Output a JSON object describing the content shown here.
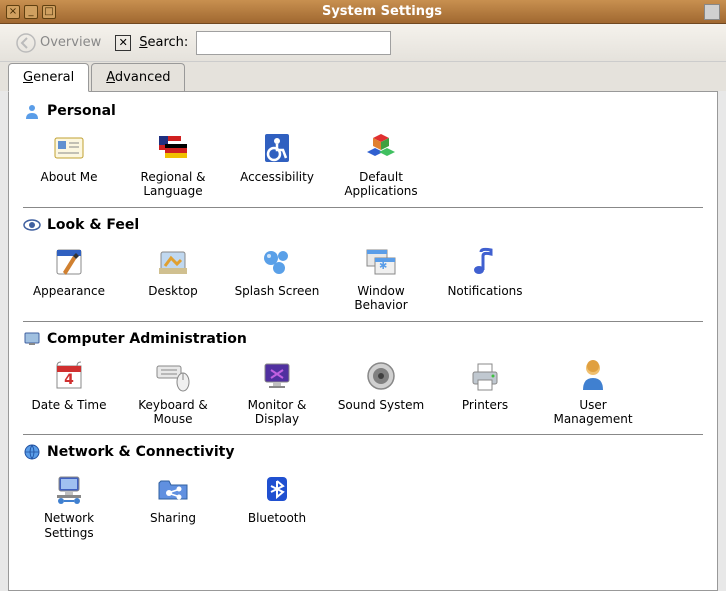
{
  "window": {
    "title": "System Settings"
  },
  "toolbar": {
    "overview": "Overview",
    "search_label": "Search:",
    "search_value": "",
    "search_placeholder": ""
  },
  "tabs": {
    "general": "General",
    "advanced": "Advanced"
  },
  "sections": [
    {
      "id": "personal",
      "title": "Personal",
      "items": [
        {
          "id": "about-me",
          "label": "About Me"
        },
        {
          "id": "regional-language",
          "label": "Regional & Language"
        },
        {
          "id": "accessibility",
          "label": "Accessibility"
        },
        {
          "id": "default-applications",
          "label": "Default Applications"
        }
      ]
    },
    {
      "id": "look-feel",
      "title": "Look & Feel",
      "items": [
        {
          "id": "appearance",
          "label": "Appearance"
        },
        {
          "id": "desktop",
          "label": "Desktop"
        },
        {
          "id": "splash-screen",
          "label": "Splash Screen"
        },
        {
          "id": "window-behavior",
          "label": "Window Behavior"
        },
        {
          "id": "notifications",
          "label": "Notifications"
        }
      ]
    },
    {
      "id": "computer-admin",
      "title": "Computer Administration",
      "items": [
        {
          "id": "date-time",
          "label": "Date & Time"
        },
        {
          "id": "keyboard-mouse",
          "label": "Keyboard & Mouse"
        },
        {
          "id": "monitor-display",
          "label": "Monitor & Display"
        },
        {
          "id": "sound-system",
          "label": "Sound System"
        },
        {
          "id": "printers",
          "label": "Printers"
        },
        {
          "id": "user-management",
          "label": "User Management"
        }
      ]
    },
    {
      "id": "network",
      "title": "Network & Connectivity",
      "items": [
        {
          "id": "network-settings",
          "label": "Network Settings"
        },
        {
          "id": "sharing",
          "label": "Sharing"
        },
        {
          "id": "bluetooth",
          "label": "Bluetooth"
        }
      ]
    }
  ]
}
